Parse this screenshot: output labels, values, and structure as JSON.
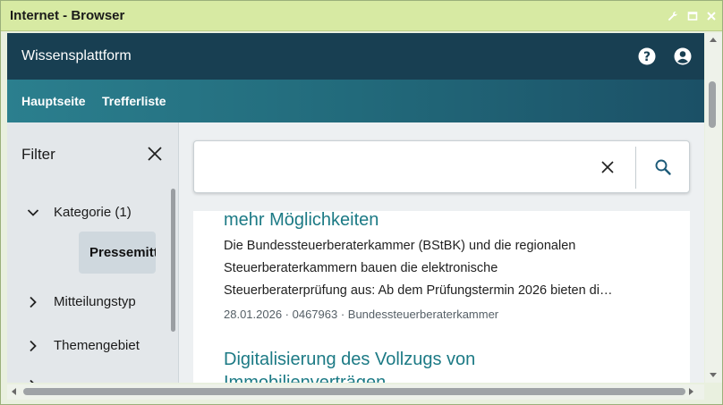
{
  "window": {
    "title": "Internet - Browser"
  },
  "app": {
    "title": "Wissensplattform",
    "nav": {
      "home": "Hauptseite",
      "hits": "Trefferliste"
    }
  },
  "filter": {
    "title": "Filter",
    "facets": [
      {
        "label": "Kategorie (1)",
        "expanded": true
      },
      {
        "label": "Mitteilungstyp",
        "expanded": false
      },
      {
        "label": "Themengebiet",
        "expanded": false
      }
    ],
    "selected_chip": "Pressemitte"
  },
  "search": {
    "value": "",
    "placeholder": ""
  },
  "results": [
    {
      "title": "mehr Möglichkeiten",
      "lines": [
        "Die Bundessteuerberaterkammer (BStBK) und die regionalen",
        "Steuerberaterkammern bauen die elektronische",
        "Steuerberaterprüfung aus: Ab dem Prüfungstermin 2026 bieten di…"
      ],
      "meta": "28.01.2026  · 0467963 ·  Bundessteuerberaterkammer"
    },
    {
      "title_lines": [
        "Digitalisierung des Vollzugs von",
        "Immobilienverträgen"
      ]
    }
  ],
  "colors": {
    "titlebar": "#d7eaa3",
    "header": "#183f52",
    "nav_start": "#2b7f8e",
    "link": "#1c7a85"
  }
}
